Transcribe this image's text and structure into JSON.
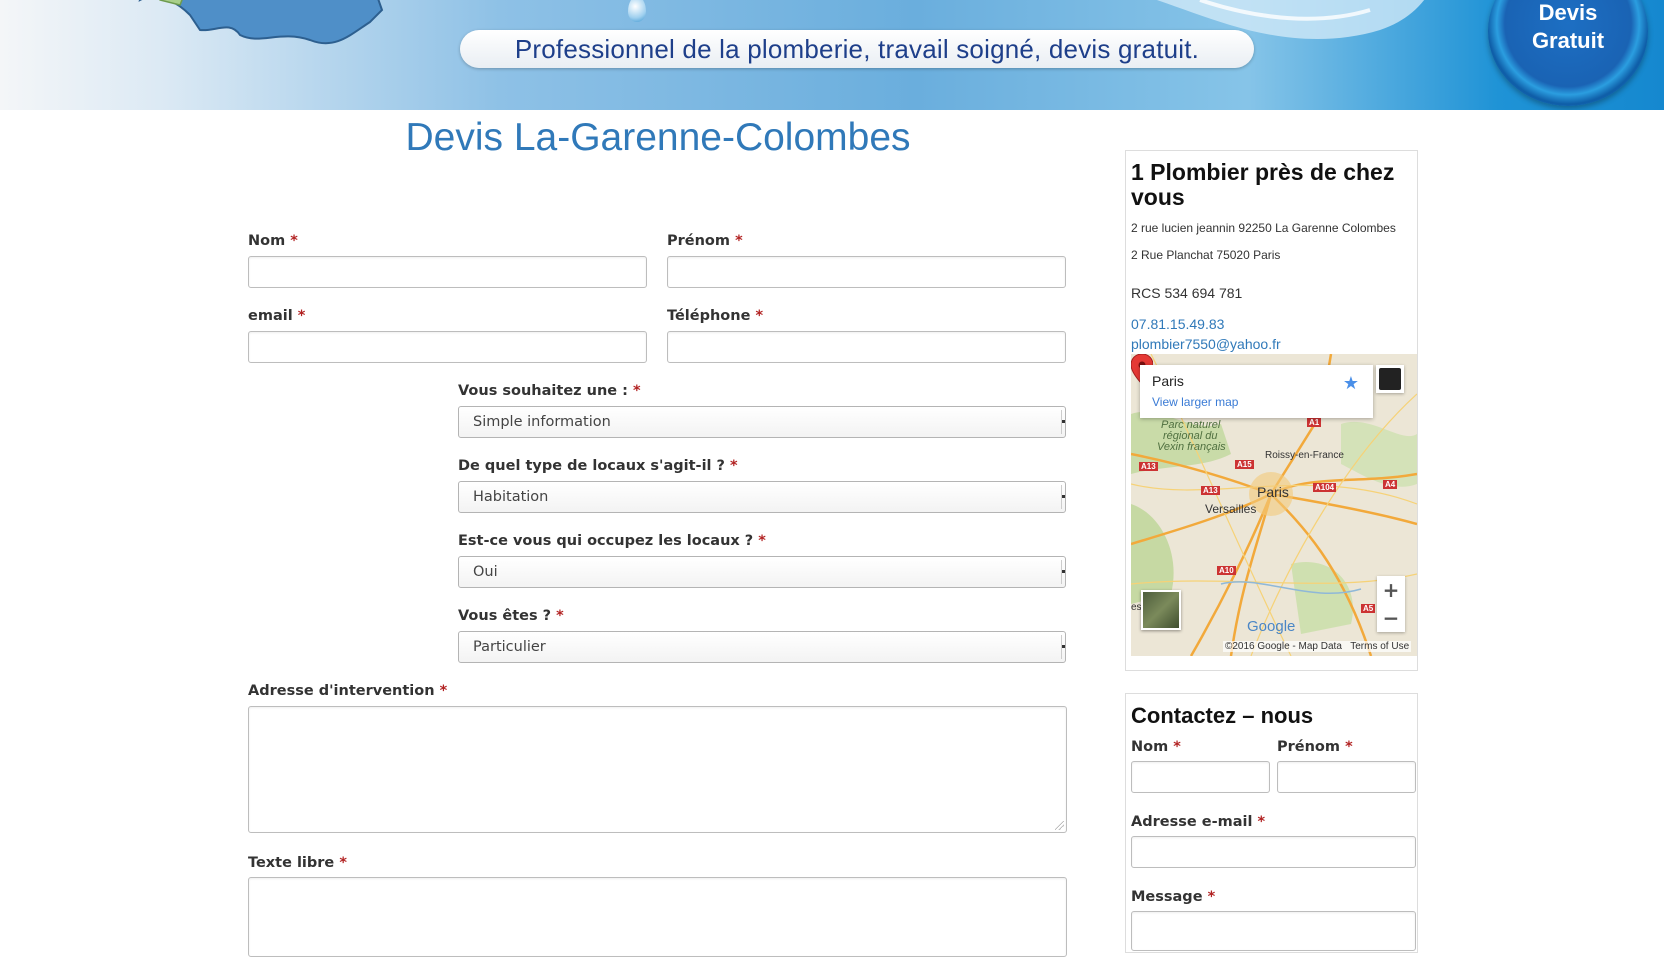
{
  "banner": {
    "tagline": "Professionnel de la plomberie, travail soigné, devis gratuit.",
    "badge_line1": "Devis",
    "badge_line2": "Gratuit"
  },
  "page_title": "Devis La-Garenne-Colombes",
  "form": {
    "required_mark": "*",
    "nom_label": "Nom",
    "prenom_label": "Prénom",
    "email_label": "email",
    "telephone_label": "Téléphone",
    "souhait_label": "Vous souhaitez une :",
    "souhait_value": "Simple information",
    "type_label": "De quel type de locaux s'agit-il ?",
    "type_value": "Habitation",
    "occupez_label": "Est-ce vous qui occupez les locaux ?",
    "occupez_value": "Oui",
    "etes_label": "Vous êtes ?",
    "etes_value": "Particulier",
    "adresse_label": "Adresse d'intervention",
    "texte_label": "Texte libre"
  },
  "sidebar": {
    "widget1": {
      "title": "1 Plombier près de chez vous",
      "address1": "2 rue lucien jeannin 92250 La Garenne Colombes",
      "address2": "2 Rue Planchat 75020 Paris",
      "rcs": "RCS 534 694 781",
      "phone": "07.81.15.49.83",
      "email": "plombier7550@yahoo.fr"
    },
    "map": {
      "city": "Paris",
      "larger_map": "View larger map",
      "zoom_in": "+",
      "zoom_out": "−",
      "google": "Google",
      "footer": "©2016 Google - Map Data",
      "terms": "Terms of Use",
      "labels": {
        "parc": "Parc naturel",
        "regional": "régional du",
        "vexin": "Vexin français",
        "roissy": "Roissy-en-France",
        "paris": "Paris",
        "versailles": "Versailles",
        "edge": "es"
      },
      "roads": {
        "a1": "A1",
        "a13": "A13",
        "a15": "A15",
        "a13b": "A13",
        "a104": "A104",
        "a4": "A4",
        "a10": "A10",
        "a5": "A5"
      }
    },
    "widget2": {
      "title": "Contactez – nous",
      "nom_label": "Nom",
      "prenom_label": "Prénom",
      "email_label": "Adresse e-mail",
      "message_label": "Message"
    }
  }
}
